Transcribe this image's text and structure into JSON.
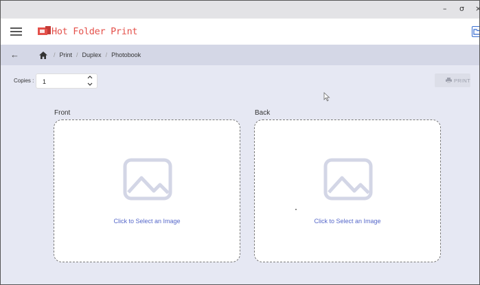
{
  "window": {
    "minimize": "–",
    "maximize": "σ",
    "close": "×"
  },
  "header": {
    "title": "Hot Folder Print",
    "menu_icon": "hamburger-icon",
    "logo_icon": "print-logo-icon",
    "action_icon": "folder-icon"
  },
  "breadcrumb": {
    "items": [
      "Print",
      "Duplex",
      "Photobook"
    ],
    "separator": "/"
  },
  "copies": {
    "label": "Copies :",
    "value": "1"
  },
  "toolbar": {
    "print_label": "PRINT"
  },
  "panels": [
    {
      "title": "Front",
      "cta": "Click to Select an Image"
    },
    {
      "title": "Back",
      "cta": "Click to Select an Image"
    }
  ],
  "colors": {
    "accent": "#5567c9",
    "brand": "#e4504a",
    "header_bg": "#ffffff",
    "crumb_bg": "#d4d7e6"
  }
}
